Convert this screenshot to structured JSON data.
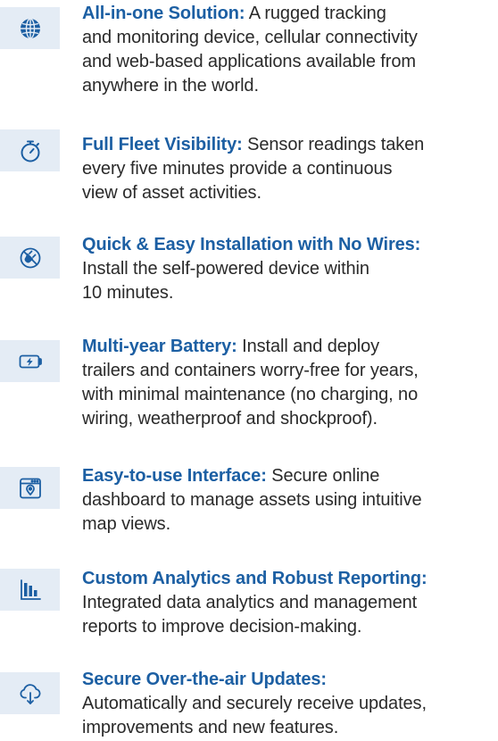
{
  "features": [
    {
      "icon": "globe-icon",
      "title": "All-in-one Solution:",
      "lines": [
        " A rugged tracking",
        "and monitoring device, cellular connectivity",
        "and web-based applications available from",
        "anywhere in the world."
      ]
    },
    {
      "icon": "stopwatch-icon",
      "title": "Full Fleet Visibility:",
      "lines": [
        " Sensor readings taken",
        "every five minutes provide a continuous",
        "view of asset activities."
      ]
    },
    {
      "icon": "no-plug-icon",
      "title": "Quick & Easy Installation with No Wires:",
      "lines": [
        "",
        "Install the self-powered device within",
        "10 minutes."
      ]
    },
    {
      "icon": "battery-icon",
      "title": "Multi-year Battery:",
      "lines": [
        " Install and deploy",
        "trailers and containers worry-free for years,",
        "with minimal maintenance (no charging, no",
        "wiring, weatherproof and shockproof)."
      ]
    },
    {
      "icon": "browser-map-pin-icon",
      "title": "Easy-to-use Interface:",
      "lines": [
        " Secure online",
        "dashboard to manage assets using intuitive",
        "map views."
      ]
    },
    {
      "icon": "bar-chart-icon",
      "title": "Custom Analytics and Robust Reporting:",
      "lines": [
        "",
        "Integrated data analytics and management",
        "reports to improve decision-making."
      ]
    },
    {
      "icon": "cloud-download-icon",
      "title": "Secure Over-the-air Updates:",
      "lines": [
        "",
        "Automatically and securely receive updates,",
        "improvements and new features."
      ]
    }
  ],
  "colors": {
    "title": "#1c5fa3",
    "body_text": "#2a2a2a",
    "icon_background": "#e4ecf5",
    "icon_stroke": "#1c5fa3"
  }
}
